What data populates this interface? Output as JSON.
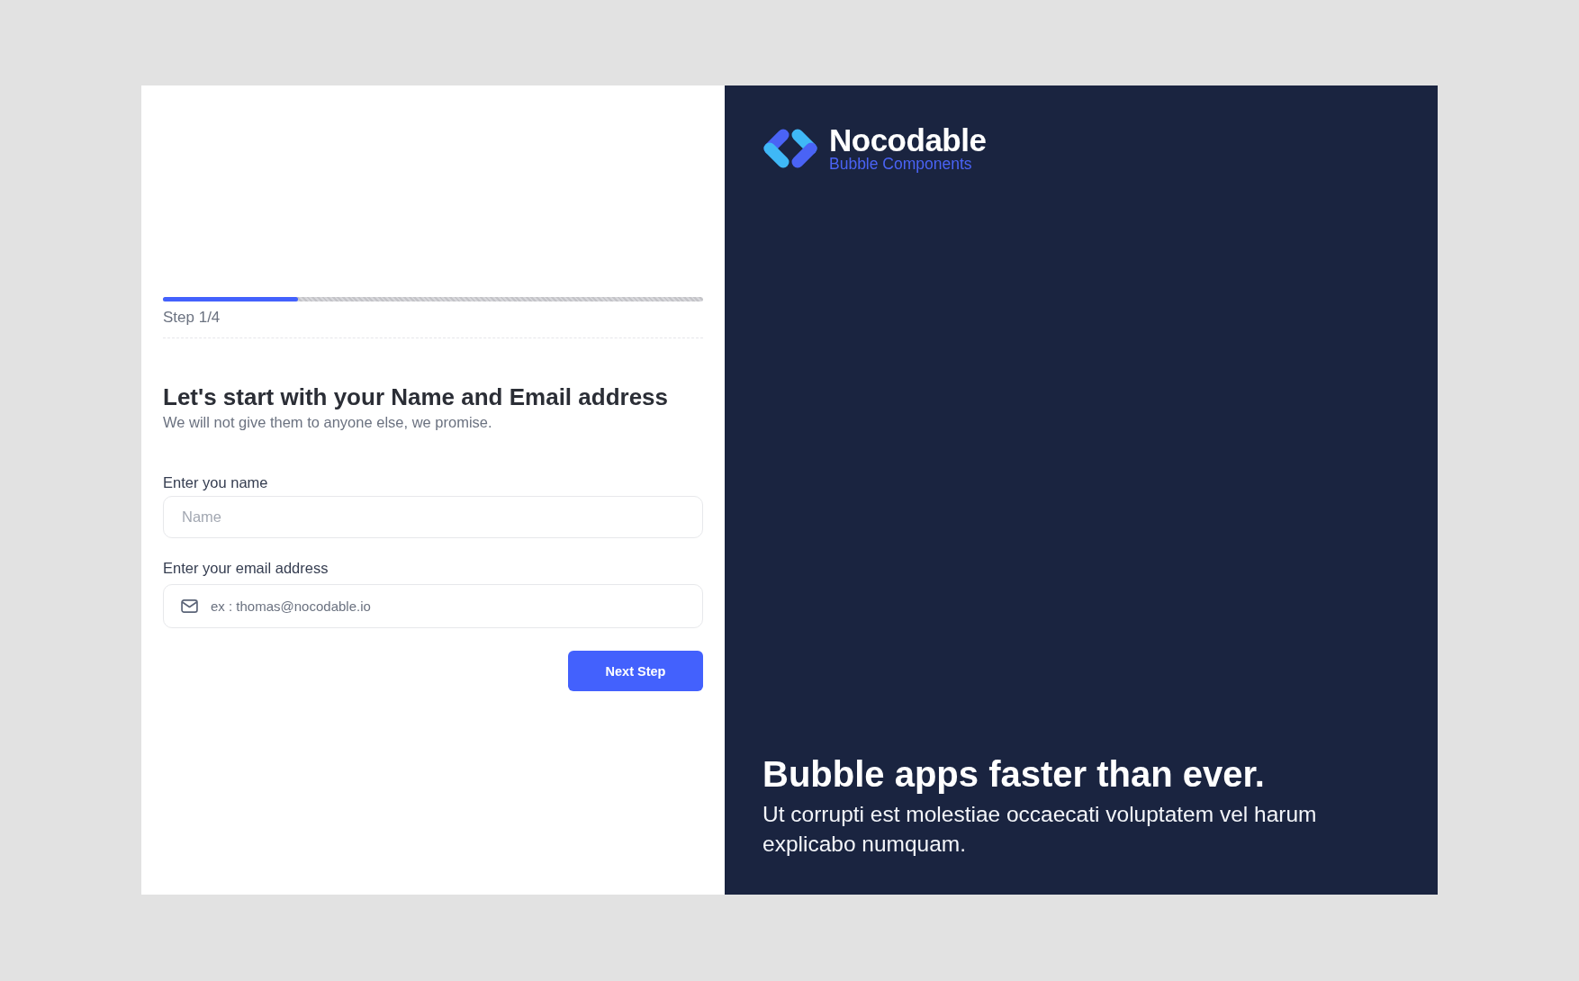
{
  "form_panel": {
    "progress": {
      "level": 0.25
    },
    "step_label": "Step 1/4",
    "heading": "Let's start with your Name and Email address",
    "subheading": "We will not give them to anyone else, we promise.",
    "fields": [
      {
        "kind": "text",
        "label": "Enter you name",
        "placeholder": "Name"
      },
      {
        "kind": "email",
        "label": "Enter your email address",
        "placeholder": "ex : thomas@nocodable.io"
      }
    ],
    "button": "Next Step"
  },
  "brand_panel": {
    "logo": {
      "name": "Nocodable",
      "tagline": "Bubble Components"
    },
    "headline": "Bubble apps faster than ever.",
    "description": "Ut corrupti est molestiae occaecati voluptatem vel harum explicabo numquam."
  }
}
